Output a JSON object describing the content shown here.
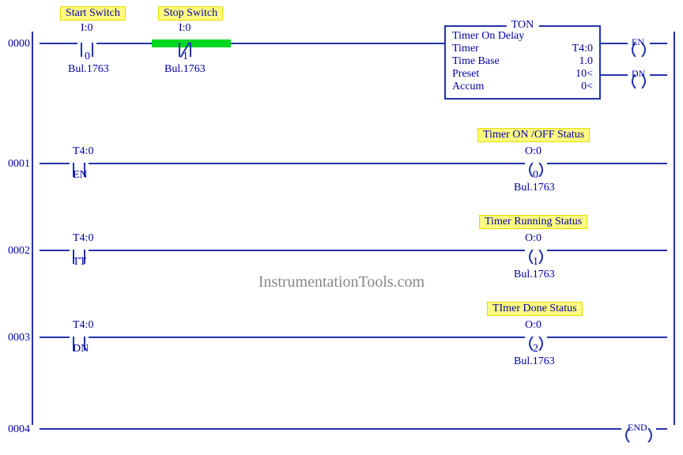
{
  "watermark": "InstrumentationTools.com",
  "rungs": {
    "r0": {
      "num": "0000",
      "start": {
        "tag": "Start Switch",
        "addr": "I:0",
        "bit": "0",
        "desc": "Bul.1763"
      },
      "stop": {
        "tag": "Stop Switch",
        "addr": "I:0",
        "bit": "1",
        "desc": "Bul.1763"
      },
      "ton": {
        "title": "TON",
        "name": "Timer On Delay",
        "rows": [
          [
            "Timer",
            "T4:0"
          ],
          [
            "Time Base",
            "1.0"
          ],
          [
            "Preset",
            "10<"
          ],
          [
            "Accum",
            "0<"
          ]
        ]
      },
      "en": "EN",
      "dn": "DN"
    },
    "r1": {
      "num": "0001",
      "in": {
        "addr": "T4:0",
        "sub": "EN"
      },
      "out": {
        "tag": "Timer ON /OFF Status",
        "addr": "O:0",
        "bit": "0",
        "desc": "Bul.1763"
      }
    },
    "r2": {
      "num": "0002",
      "in": {
        "addr": "T4:0",
        "sub": "TT"
      },
      "out": {
        "tag": "Timer Running Status",
        "addr": "O:0",
        "bit": "1",
        "desc": "Bul.1763"
      }
    },
    "r3": {
      "num": "0003",
      "in": {
        "addr": "T4:0",
        "sub": "DN"
      },
      "out": {
        "tag": "TImer Done Status",
        "addr": "O:0",
        "bit": "2",
        "desc": "Bul.1763"
      }
    },
    "r4": {
      "num": "0004",
      "end": "END"
    }
  }
}
